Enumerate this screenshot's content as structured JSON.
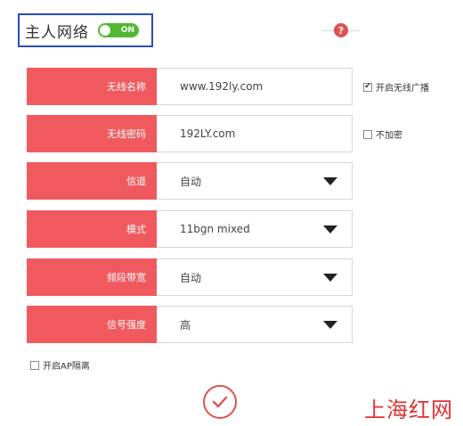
{
  "header": {
    "title": "主人网络",
    "toggle_label": "ON"
  },
  "help": {
    "icon": "?"
  },
  "form": {
    "ssid": {
      "label": "无线名称",
      "value": "www.192ly.com"
    },
    "password": {
      "label": "无线密码",
      "value": "192LY.com"
    },
    "channel": {
      "label": "信道",
      "value": "自动"
    },
    "mode": {
      "label": "模式",
      "value": "11bgn mixed"
    },
    "bandwidth": {
      "label": "频段带宽",
      "value": "自动"
    },
    "signal": {
      "label": "信号强度",
      "value": "高"
    }
  },
  "options": {
    "broadcast": {
      "label": "开启无线广播",
      "mark": "✔"
    },
    "no_encrypt": {
      "label": "不加密"
    },
    "ap_isolation": {
      "label": "开启AP隔离"
    }
  },
  "watermark": {
    "text": "上海红网"
  },
  "colors": {
    "accent": "#f05a5e",
    "toggle_on": "#52b832",
    "header_border": "#2a4fb8"
  }
}
